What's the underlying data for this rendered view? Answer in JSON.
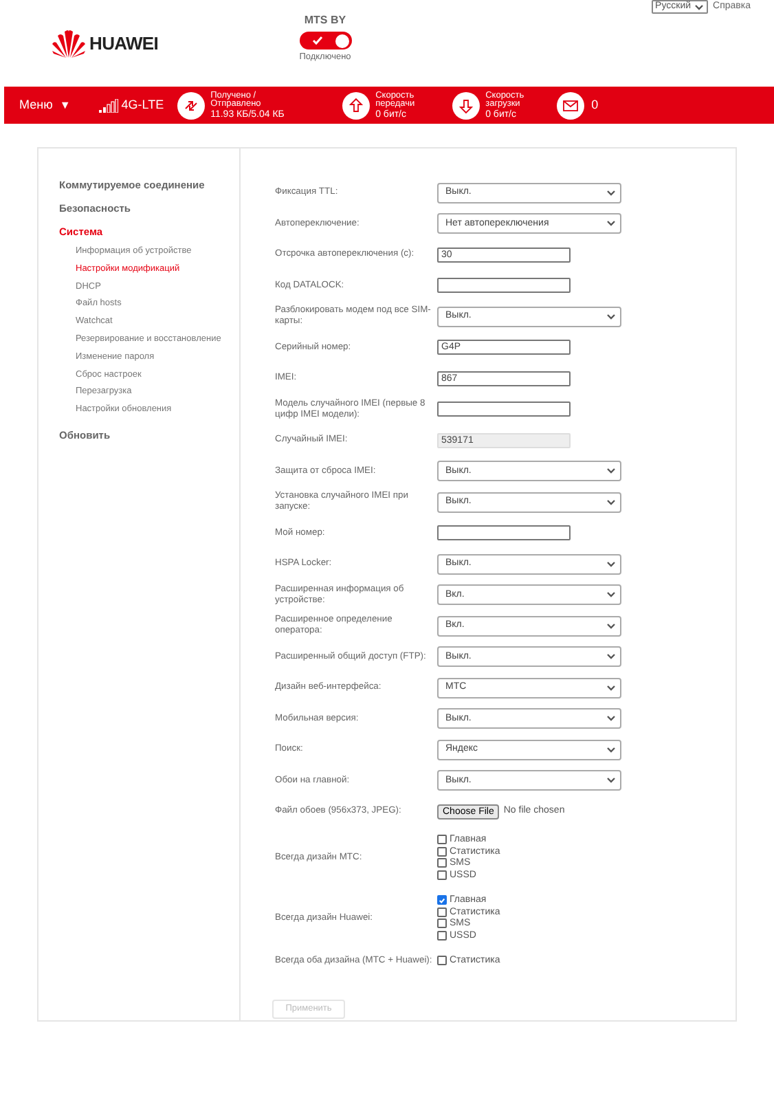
{
  "header": {
    "operator": "MTS BY",
    "connection": {
      "label": "Подключено",
      "on": true
    },
    "language": "Русский",
    "help": "Справка",
    "logo": "HUAWEI"
  },
  "status_bar": {
    "menu": "Меню",
    "menu_caret": "▼",
    "network": "4G-LTE",
    "traffic": {
      "label": "Получено / Отправлено",
      "value": "11.93 КБ/5.04 КБ"
    },
    "upload": {
      "label": "Скорость передачи",
      "value": "0 бит/с"
    },
    "download": {
      "label": "Скорость загрузки",
      "value": "0 бит/с"
    },
    "messages": "0"
  },
  "sidebar": {
    "items": [
      {
        "label": "Коммутируемое соединение",
        "selected": false
      },
      {
        "label": "Безопасность",
        "selected": false
      },
      {
        "label": "Система",
        "selected": true,
        "children": [
          {
            "label": "Информация об устройстве",
            "selected": false
          },
          {
            "label": "Настройки модификаций",
            "selected": true
          },
          {
            "label": "DHCP",
            "selected": false
          },
          {
            "label": "Файл hosts",
            "selected": false
          },
          {
            "label": "Watchcat",
            "selected": false
          },
          {
            "label": "Резервирование и восстановление",
            "selected": false
          },
          {
            "label": "Изменение пароля",
            "selected": false
          },
          {
            "label": "Сброс настроек",
            "selected": false
          },
          {
            "label": "Перезагрузка",
            "selected": false
          },
          {
            "label": "Настройки обновления",
            "selected": false
          }
        ]
      },
      {
        "label": "Обновить",
        "selected": false
      }
    ]
  },
  "form": {
    "rows": [
      {
        "kind": "select",
        "label": "Фиксация TTL:",
        "value": "Выкл."
      },
      {
        "kind": "select",
        "label": "Автопереключение:",
        "value": "Нет автопереключения"
      },
      {
        "kind": "text",
        "label": "Отсрочка автопереключения (с):",
        "value": "30"
      },
      {
        "kind": "text",
        "label": "Код DATALOCK:"
      },
      {
        "kind": "select",
        "label": "Разблокировать модем под все SIM-карты:",
        "value": "Выкл."
      },
      {
        "kind": "text",
        "label": "Серийный номер:",
        "value": "G4P"
      },
      {
        "kind": "text",
        "label": "IMEI:",
        "value": "867"
      },
      {
        "kind": "text",
        "label": "Модель случайного IMEI (первые 8 цифр IMEI модели):"
      },
      {
        "kind": "readonly",
        "label": "Случайный IMEI:",
        "value": "539171"
      },
      {
        "kind": "select",
        "label": "Защита от сброса IMEI:",
        "value": "Выкл."
      },
      {
        "kind": "select",
        "label": "Установка случайного IMEI при запуске:",
        "value": "Выкл."
      },
      {
        "kind": "text",
        "label": "Мой номер:"
      },
      {
        "kind": "select",
        "label": "HSPA Locker:",
        "value": "Выкл."
      },
      {
        "kind": "select",
        "label": "Расширенная информация об устройстве:",
        "value": "Вкл."
      },
      {
        "kind": "select",
        "label": "Расширенное определение оператора:",
        "value": "Вкл."
      },
      {
        "kind": "select",
        "label": "Расширенный общий доступ (FTP):",
        "value": "Выкл."
      },
      {
        "kind": "select",
        "label": "Дизайн веб-интерфейса:",
        "value": "МТС"
      },
      {
        "kind": "select",
        "label": "Мобильная версия:",
        "value": "Выкл."
      },
      {
        "kind": "select",
        "label": "Поиск:",
        "value": "Яндекс"
      },
      {
        "kind": "select",
        "label": "Обои на главной:",
        "value": "Выкл."
      },
      {
        "kind": "file",
        "label": "Файл обоев (956x373, JPEG):",
        "button": "Choose File",
        "status": "No file chosen"
      },
      {
        "kind": "checkboxes",
        "label": "Всегда дизайн МТС:",
        "options": [
          {
            "label": "Главная",
            "checked": false
          },
          {
            "label": "Статистика",
            "checked": false
          },
          {
            "label": "SMS",
            "checked": false
          },
          {
            "label": "USSD",
            "checked": false
          }
        ]
      },
      {
        "kind": "checkboxes",
        "label": "Всегда дизайн Huawei:",
        "options": [
          {
            "label": "Главная",
            "checked": true
          },
          {
            "label": "Статистика",
            "checked": false
          },
          {
            "label": "SMS",
            "checked": false
          },
          {
            "label": "USSD",
            "checked": false
          }
        ]
      },
      {
        "kind": "checkboxes",
        "label": "Всегда оба дизайна (МТС + Huawei):",
        "options": [
          {
            "label": "Статистика",
            "checked": false
          }
        ]
      }
    ],
    "apply": {
      "label": "Применить",
      "disabled": true
    }
  }
}
